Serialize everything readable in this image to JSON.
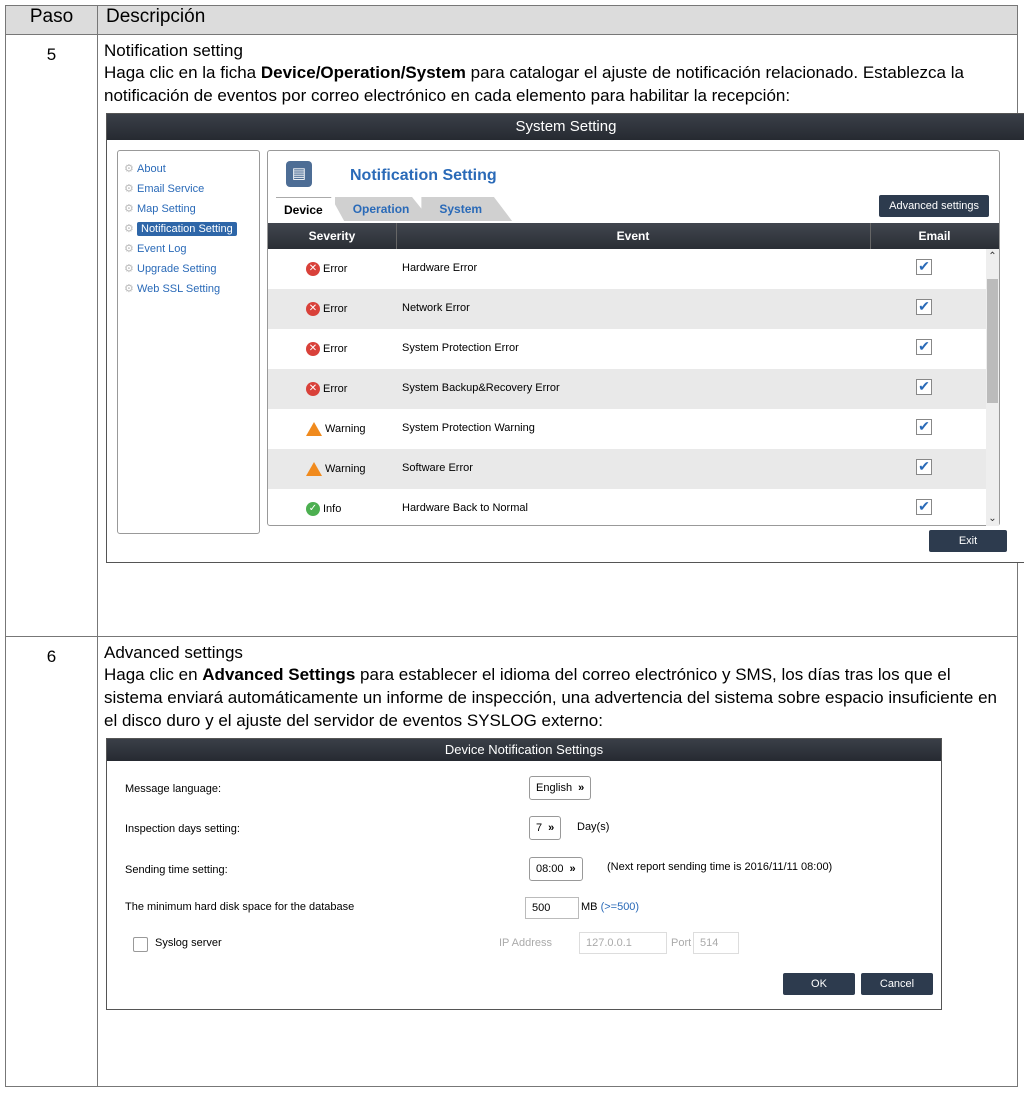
{
  "table": {
    "col_paso": "Paso",
    "col_desc": "Descripción"
  },
  "step5": {
    "num": "5",
    "heading": "Notification setting",
    "text_a": "Haga clic en la ficha ",
    "text_bold": "Device/Operation/System",
    "text_b": " para catalogar el ajuste de notificación relacionado. Establezca la notificación de eventos por correo electrónico en cada elemento para habilitar la recepción:"
  },
  "system_window": {
    "title": "System Setting",
    "nav": [
      {
        "label": "About",
        "active": false
      },
      {
        "label": "Email Service",
        "active": false
      },
      {
        "label": "Map Setting",
        "active": false
      },
      {
        "label": "Notification Setting",
        "active": true
      },
      {
        "label": "Event Log",
        "active": false
      },
      {
        "label": "Upgrade Setting",
        "active": false
      },
      {
        "label": "Web SSL Setting",
        "active": false
      }
    ],
    "panel_title": "Notification Setting",
    "tabs": [
      "Device",
      "Operation",
      "System"
    ],
    "advanced_btn": "Advanced settings",
    "columns": {
      "severity": "Severity",
      "event": "Event",
      "email": "Email"
    },
    "rows": [
      {
        "severity": "Error",
        "type": "error",
        "event": "Hardware Error",
        "email": true
      },
      {
        "severity": "Error",
        "type": "error",
        "event": "Network Error",
        "email": true
      },
      {
        "severity": "Error",
        "type": "error",
        "event": "System Protection Error",
        "email": true
      },
      {
        "severity": "Error",
        "type": "error",
        "event": "System Backup&Recovery Error",
        "email": true
      },
      {
        "severity": "Warning",
        "type": "warning",
        "event": "System Protection Warning",
        "email": true
      },
      {
        "severity": "Warning",
        "type": "warning",
        "event": "Software Error",
        "email": true
      },
      {
        "severity": "Info",
        "type": "info",
        "event": "Hardware Back to Normal",
        "email": true
      }
    ],
    "exit_btn": "Exit"
  },
  "step6": {
    "num": "6",
    "heading": "Advanced settings",
    "text_a": "Haga clic en ",
    "text_bold": "Advanced Settings",
    "text_b": " para establecer el idioma del correo electrónico y SMS, los días tras los que el sistema enviará automáticamente un informe de inspección, una advertencia del sistema sobre espacio insuficiente en el disco duro y el ajuste del servidor de eventos SYSLOG externo:"
  },
  "device_window": {
    "title": "Device Notification Settings",
    "message_language_label": "Message language:",
    "message_language_value": "English",
    "inspection_label": "Inspection days setting:",
    "inspection_value": "7",
    "inspection_unit": "Day(s)",
    "sending_label": "Sending time setting:",
    "sending_value": "08:00",
    "sending_note": "(Next report sending time is 2016/11/11 08:00)",
    "disk_label": "The minimum hard disk space for the database",
    "disk_value": "500",
    "disk_unit": "MB",
    "disk_hint": "(>=500)",
    "syslog_label": "Syslog server",
    "syslog_checked": false,
    "ip_label": "IP Address",
    "ip_value": "127.0.0.1",
    "port_label": "Port",
    "port_value": "514",
    "ok_btn": "OK",
    "cancel_btn": "Cancel"
  }
}
